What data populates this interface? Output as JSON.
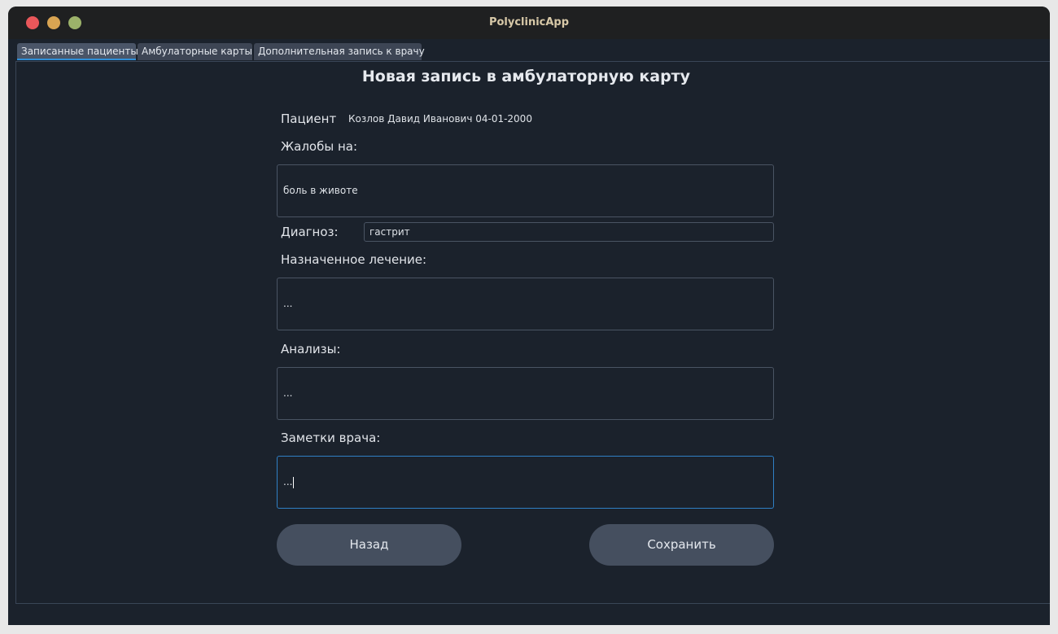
{
  "window": {
    "title": "PolyclinicApp"
  },
  "tabs": [
    {
      "label": "Записанные пациенты",
      "active": true
    },
    {
      "label": "Амбулаторные карты",
      "active": false
    },
    {
      "label": "Дополнительная запись к врачу",
      "active": false
    }
  ],
  "form": {
    "title": "Новая запись в амбулаторную карту",
    "patient_label": "Пациент",
    "patient_value": "Козлов Давид Иванович 04-01-2000",
    "complaints_label": "Жалобы на:",
    "complaints_value": "боль в животе",
    "diagnosis_label": "Диагноз:",
    "diagnosis_value": "гастрит",
    "treatment_label": "Назначенное лечение:",
    "treatment_value": "...",
    "tests_label": "Анализы:",
    "tests_value": "...",
    "notes_label": "Заметки врача:",
    "notes_value": "..."
  },
  "buttons": {
    "back": "Назад",
    "save": "Сохранить"
  },
  "colors": {
    "accent": "#2f8fd8",
    "background": "#1b222c",
    "button": "#454f5f"
  }
}
